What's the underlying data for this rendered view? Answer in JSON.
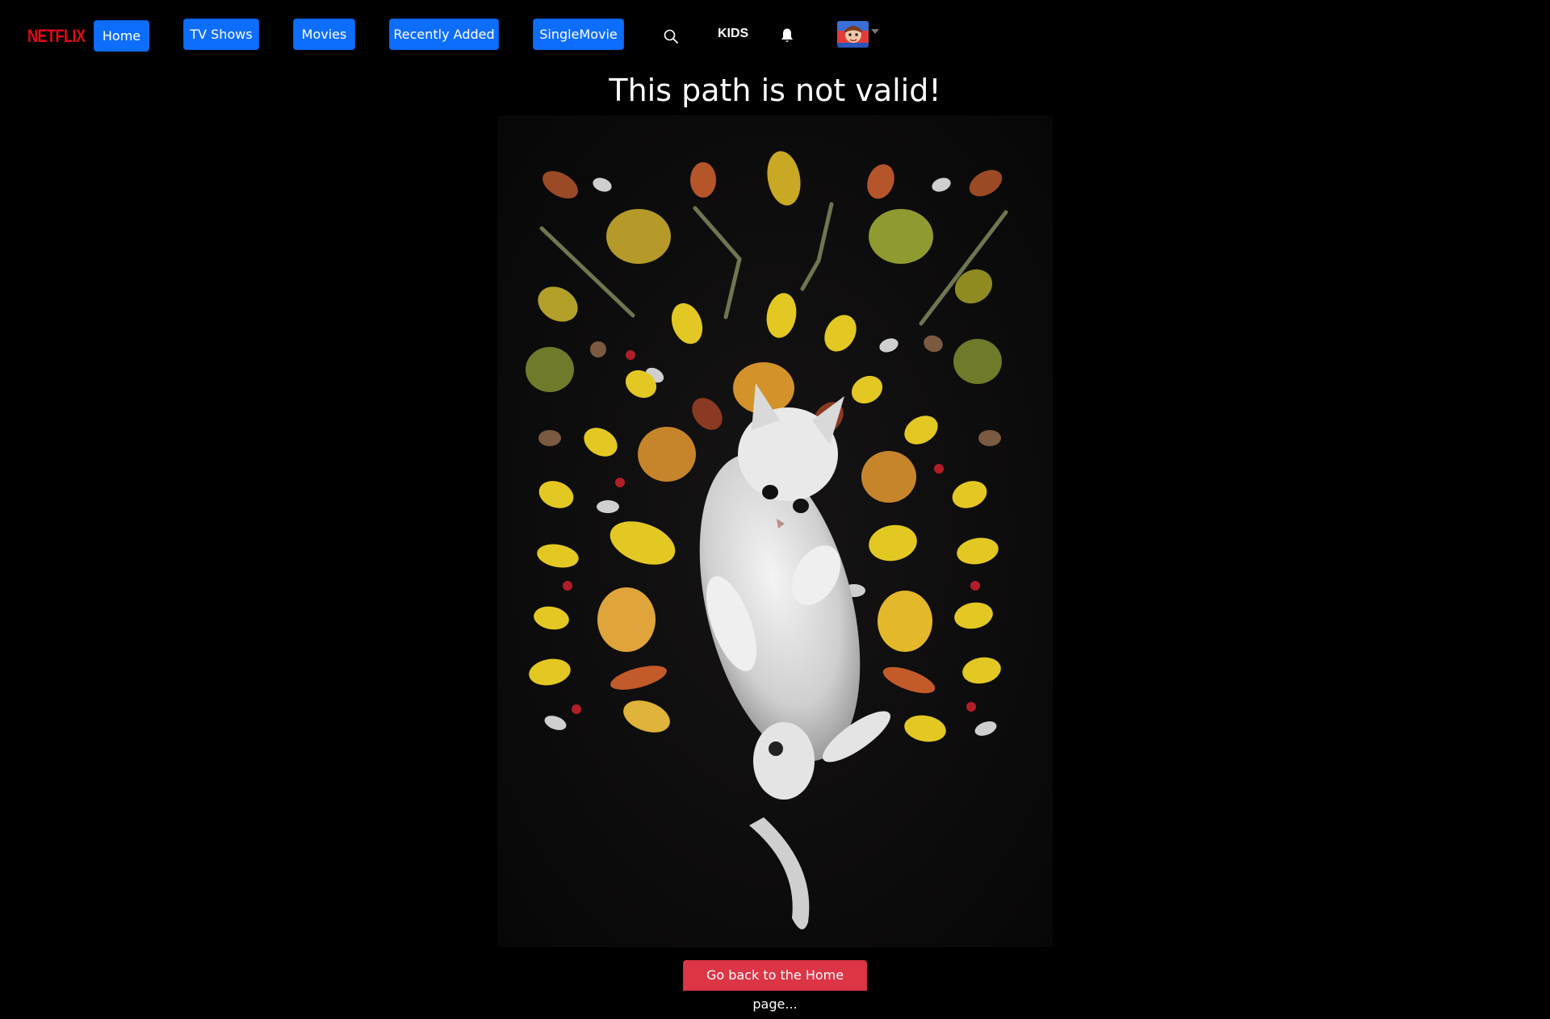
{
  "nav": {
    "logo": "NETFLIX",
    "buttons": {
      "home": "Home",
      "tv_shows": "TV Shows",
      "movies": "Movies",
      "recently_added": "Recently Added",
      "single_movie": "SingleMovie"
    },
    "kids": "KIDS",
    "icons": {
      "search": "search-icon",
      "notifications": "bell-icon",
      "profile_menu": "chevron-down-icon"
    }
  },
  "main": {
    "title": "This path is not valid!",
    "image": "white kitten lying among autumn leaves on a black background",
    "back_button": "Go back to the Home page..."
  },
  "colors": {
    "background": "#000000",
    "logo": "#e50914",
    "primary_button": "#0d6efd",
    "danger_button": "#dc3545"
  }
}
